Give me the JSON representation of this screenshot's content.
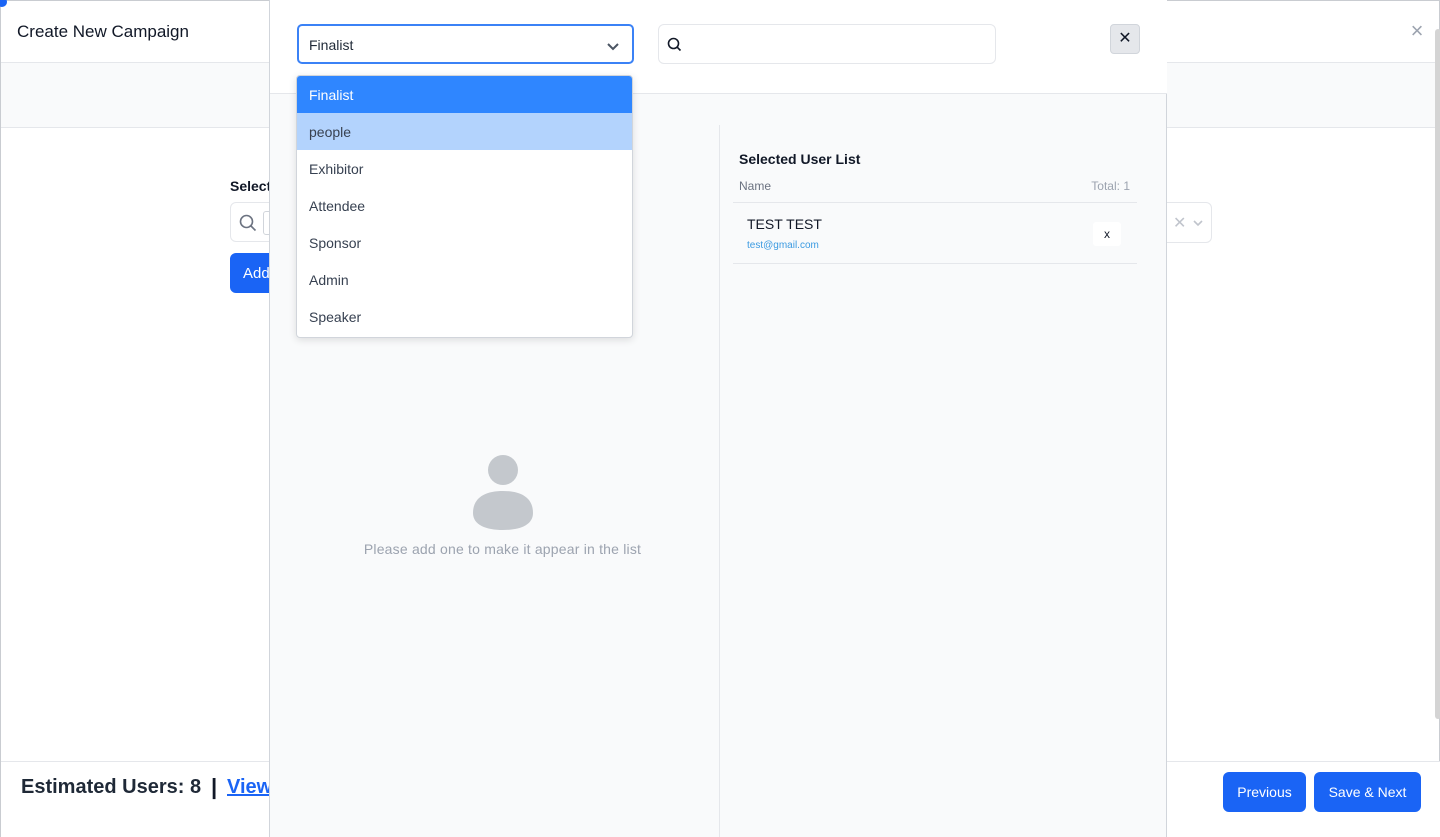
{
  "campaign": {
    "title": "Create New Campaign",
    "select_label": "Select",
    "add_button": "Add",
    "footer": {
      "estimated_users": "Estimated Users: 8",
      "separator": "|",
      "view_link": "View",
      "previous": "Previous",
      "save_next": "Save & Next"
    }
  },
  "modal": {
    "role_select": {
      "value": "Finalist",
      "options": [
        "Finalist",
        "people",
        "Exhibitor",
        "Attendee",
        "Sponsor",
        "Admin",
        "Speaker"
      ]
    },
    "search": {
      "placeholder": ""
    },
    "close_glyph": "✕",
    "empty_state": {
      "text": "Please add one to make it appear in the list"
    },
    "selected_list": {
      "title": "Selected User List",
      "name_header": "Name",
      "total": "Total: 1",
      "users": [
        {
          "name": "TEST TEST",
          "email": "test@gmail.com",
          "remove": "x"
        }
      ]
    }
  },
  "colors": {
    "primary": "#1a64f5",
    "option_selected": "#2f86ff",
    "option_hover": "#b3d3fd",
    "email": "#3b9ae1"
  }
}
